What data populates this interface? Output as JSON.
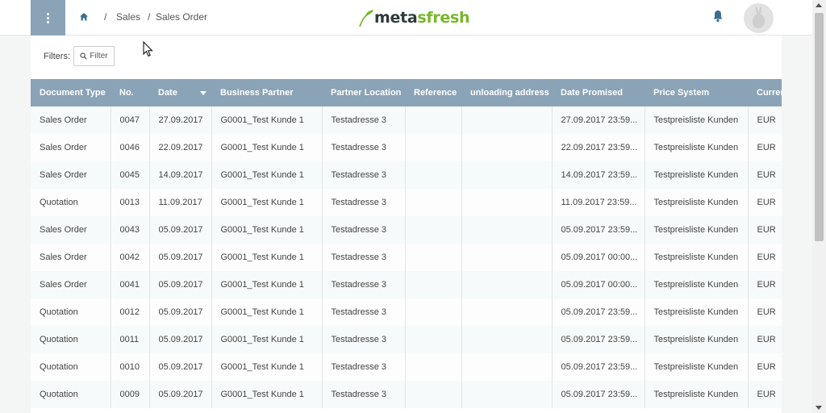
{
  "header": {
    "breadcrumb": [
      "Sales",
      "Sales Order"
    ],
    "logo_prefix": "meta",
    "logo_accent": "sfresh",
    "brand_color": "#8aa3b6",
    "logo_green": "#77b82a"
  },
  "filters": {
    "label": "Filters:",
    "button_label": "Filter"
  },
  "table": {
    "columns": [
      "Document Type",
      "No.",
      "Date",
      "Business Partner",
      "Partner Location",
      "Reference",
      "unloading address",
      "Date Promised",
      "Price System",
      "Currer"
    ],
    "sorted_column": "Date",
    "rows": [
      [
        "Sales Order",
        "0047",
        "27.09.2017",
        "G0001_Test Kunde 1",
        "Testadresse 3",
        "",
        "",
        "27.09.2017 23:59...",
        "Testpreisliste Kunden",
        "EUR"
      ],
      [
        "Sales Order",
        "0046",
        "22.09.2017",
        "G0001_Test Kunde 1",
        "Testadresse 3",
        "",
        "",
        "22.09.2017 23:59...",
        "Testpreisliste Kunden",
        "EUR"
      ],
      [
        "Sales Order",
        "0045",
        "14.09.2017",
        "G0001_Test Kunde 1",
        "Testadresse 3",
        "",
        "",
        "14.09.2017 23:59...",
        "Testpreisliste Kunden",
        "EUR"
      ],
      [
        "Quotation",
        "0013",
        "11.09.2017",
        "G0001_Test Kunde 1",
        "Testadresse 3",
        "",
        "",
        "11.09.2017 23:59...",
        "Testpreisliste Kunden",
        "EUR"
      ],
      [
        "Sales Order",
        "0043",
        "05.09.2017",
        "G0001_Test Kunde 1",
        "Testadresse 3",
        "",
        "",
        "05.09.2017 23:59...",
        "Testpreisliste Kunden",
        "EUR"
      ],
      [
        "Sales Order",
        "0042",
        "05.09.2017",
        "G0001_Test Kunde 1",
        "Testadresse 3",
        "",
        "",
        "05.09.2017 00:00...",
        "Testpreisliste Kunden",
        "EUR"
      ],
      [
        "Sales Order",
        "0041",
        "05.09.2017",
        "G0001_Test Kunde 1",
        "Testadresse 3",
        "",
        "",
        "05.09.2017 00:00...",
        "Testpreisliste Kunden",
        "EUR"
      ],
      [
        "Quotation",
        "0012",
        "05.09.2017",
        "G0001_Test Kunde 1",
        "Testadresse 3",
        "",
        "",
        "05.09.2017 23:59...",
        "Testpreisliste Kunden",
        "EUR"
      ],
      [
        "Quotation",
        "0011",
        "05.09.2017",
        "G0001_Test Kunde 1",
        "Testadresse 3",
        "",
        "",
        "05.09.2017 23:59...",
        "Testpreisliste Kunden",
        "EUR"
      ],
      [
        "Quotation",
        "0010",
        "05.09.2017",
        "G0001_Test Kunde 1",
        "Testadresse 3",
        "",
        "",
        "05.09.2017 23:59...",
        "Testpreisliste Kunden",
        "EUR"
      ],
      [
        "Quotation",
        "0009",
        "05.09.2017",
        "G0001_Test Kunde 1",
        "Testadresse 3",
        "",
        "",
        "05.09.2017 23:59...",
        "Testpreisliste Kunden",
        "EUR"
      ]
    ]
  }
}
